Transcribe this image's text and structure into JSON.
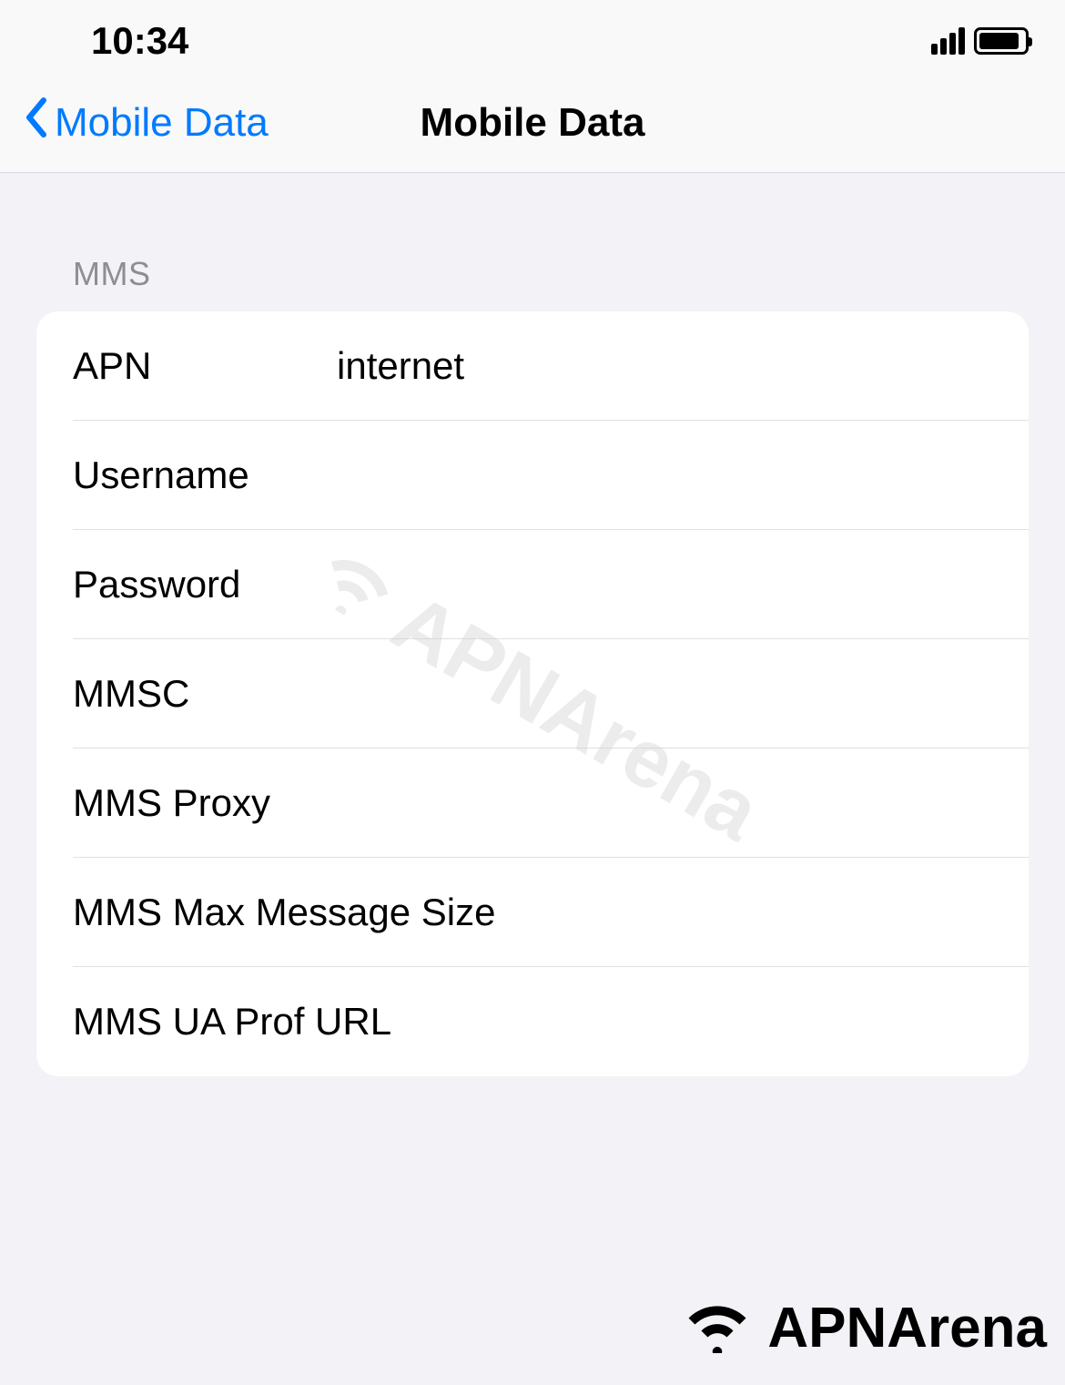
{
  "status_bar": {
    "time": "10:34"
  },
  "nav": {
    "back_label": "Mobile Data",
    "title": "Mobile Data"
  },
  "section": {
    "header": "MMS",
    "rows": [
      {
        "label": "APN",
        "value": "internet"
      },
      {
        "label": "Username",
        "value": ""
      },
      {
        "label": "Password",
        "value": ""
      },
      {
        "label": "MMSC",
        "value": ""
      },
      {
        "label": "MMS Proxy",
        "value": ""
      },
      {
        "label": "MMS Max Message Size",
        "value": ""
      },
      {
        "label": "MMS UA Prof URL",
        "value": ""
      }
    ]
  },
  "watermark": "APNArena",
  "footer_brand": "APNArena"
}
